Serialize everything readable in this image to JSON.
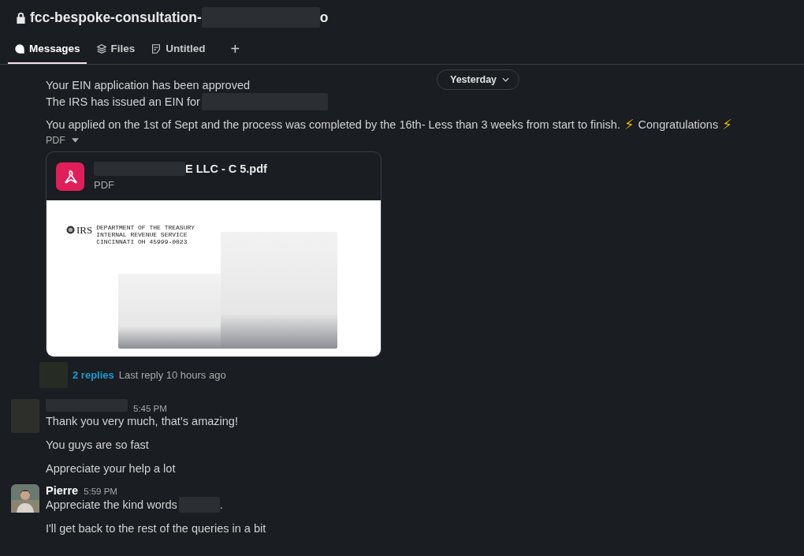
{
  "channel": {
    "title": "fcc-bespoke-consultation-",
    "title_end": "o",
    "private": true
  },
  "tabs": [
    {
      "label": "Messages",
      "kind": "messages",
      "selected": true
    },
    {
      "label": "Files",
      "kind": "files",
      "selected": false
    },
    {
      "label": "Untitled",
      "kind": "canvas",
      "selected": false
    }
  ],
  "add_tab": "+",
  "date_divider": "Yesterday",
  "first_message": {
    "lines": [
      "Your EIN application has been approved",
      "The IRS has issued an EIN for"
    ],
    "paragraph": "You applied on the 1st of Sept and the process was completed by the 16th- Less than 3 weeks from start to finish.",
    "bolt": "⚡",
    "congrats": "Congratulations",
    "bolt_end": "⚡",
    "attachment_label": "PDF",
    "file": {
      "name": "E LLC - C   5.pdf",
      "type": "PDF",
      "preview": {
        "agency": "IRS",
        "lines": [
          "DEPARTMENT OF THE TREASURY",
          "INTERNAL REVENUE SERVICE",
          "CINCINNATI OH 45999-0023"
        ]
      }
    },
    "thread": {
      "replies": "2 replies",
      "last_reply": "Last reply 10 hours ago"
    }
  },
  "messages": [
    {
      "kind": "redacted",
      "time": "5:45 PM",
      "lines": [
        "Thank you very much, that’s amazing!",
        "You guys are so fast",
        "Appreciate your help a lot"
      ]
    },
    {
      "kind": "photo",
      "author": "Pierre",
      "time": "5:59 PM",
      "lines": [
        "Appreciate the kind words",
        "I'll get back to the rest of the queries in a bit"
      ],
      "redacted_tail": "."
    }
  ]
}
